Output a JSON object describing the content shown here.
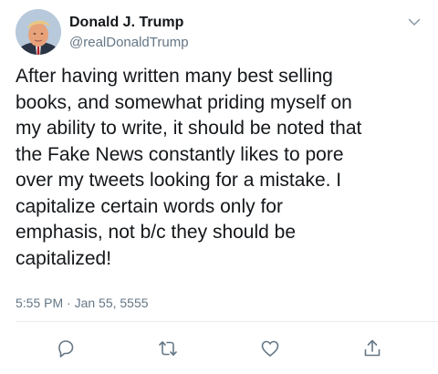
{
  "author": {
    "display_name": "Donald J. Trump",
    "handle": "@realDonaldTrump",
    "avatar_icon": "profile-photo"
  },
  "tweet": {
    "text": "After having written many best selling\nbooks, and somewhat priding myself on\nmy ability to write, it should be noted that\nthe Fake News constantly likes to pore\nover my tweets looking for a mistake. I\ncapitalize certain words only for\nemphasis, not b/c they should be\ncapitalized!",
    "timestamp": "5:55 PM · Jan 55, 5555"
  },
  "actions": {
    "reply_icon": "reply-icon",
    "retweet_icon": "retweet-icon",
    "like_icon": "heart-icon",
    "share_icon": "share-icon",
    "menu_icon": "chevron-down-icon"
  },
  "colors": {
    "text_primary": "#14171a",
    "text_secondary": "#657786",
    "icon_gray": "#657786",
    "divider": "#e6ecf0"
  }
}
